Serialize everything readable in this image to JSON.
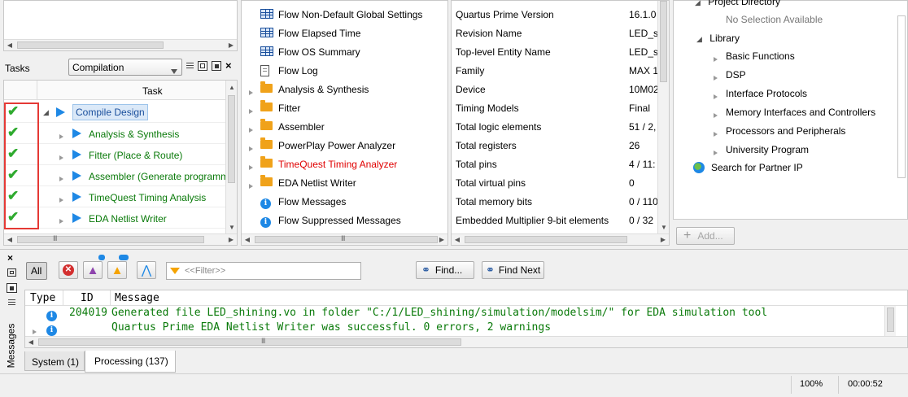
{
  "tasks_pane": {
    "label": "Tasks",
    "flow_select": "Compilation",
    "column_task": "Task",
    "items": [
      {
        "label": "Compile Design",
        "status": "done",
        "color": "#1a4f9c",
        "expanded": true
      },
      {
        "label": "Analysis & Synthesis",
        "status": "done",
        "color": "#0a7a0a"
      },
      {
        "label": "Fitter (Place & Route)",
        "status": "done",
        "color": "#0a7a0a"
      },
      {
        "label": "Assembler (Generate programm",
        "status": "done",
        "color": "#0a7a0a"
      },
      {
        "label": "TimeQuest Timing Analysis",
        "status": "done",
        "color": "#0a7a0a"
      },
      {
        "label": "EDA Netlist Writer",
        "status": "done",
        "color": "#0a7a0a"
      }
    ]
  },
  "report_list": {
    "items": [
      {
        "icon": "table-icon",
        "label": "Flow Non-Default Global Settings",
        "expandable": false
      },
      {
        "icon": "table-icon",
        "label": "Flow Elapsed Time",
        "expandable": false
      },
      {
        "icon": "table-icon",
        "label": "Flow OS Summary",
        "expandable": false
      },
      {
        "icon": "document-icon",
        "label": "Flow Log",
        "expandable": false
      },
      {
        "icon": "folder-icon",
        "label": "Analysis & Synthesis",
        "expandable": true
      },
      {
        "icon": "folder-icon",
        "label": "Fitter",
        "expandable": true
      },
      {
        "icon": "folder-icon",
        "label": "Assembler",
        "expandable": true
      },
      {
        "icon": "folder-icon",
        "label": "PowerPlay Power Analyzer",
        "expandable": true
      },
      {
        "icon": "folder-icon",
        "label": "TimeQuest Timing Analyzer",
        "expandable": true,
        "color": "#e00000"
      },
      {
        "icon": "folder-icon",
        "label": "EDA Netlist Writer",
        "expandable": true
      },
      {
        "icon": "info-icon",
        "label": "Flow Messages",
        "expandable": false
      },
      {
        "icon": "info-icon",
        "label": "Flow Suppressed Messages",
        "expandable": false
      }
    ]
  },
  "summary": {
    "rows": [
      {
        "name": "Quartus Prime Version",
        "value": "16.1.0"
      },
      {
        "name": "Revision Name",
        "value": "LED_s"
      },
      {
        "name": "Top-level Entity Name",
        "value": "LED_s"
      },
      {
        "name": "Family",
        "value": "MAX 1"
      },
      {
        "name": "Device",
        "value": "10M02"
      },
      {
        "name": "Timing Models",
        "value": "Final"
      },
      {
        "name": "Total logic elements",
        "value": "51 / 2,"
      },
      {
        "name": "Total registers",
        "value": "26"
      },
      {
        "name": "Total pins",
        "value": "4 / 11:"
      },
      {
        "name": "Total virtual pins",
        "value": "0"
      },
      {
        "name": "Total memory bits",
        "value": "0 / 110"
      },
      {
        "name": "Embedded Multiplier 9-bit elements",
        "value": "0 / 32"
      }
    ]
  },
  "ip_catalog": {
    "project_directory": "Project Directory",
    "no_selection": "No Selection Available",
    "library": "Library",
    "items": [
      "Basic Functions",
      "DSP",
      "Interface Protocols",
      "Memory Interfaces and Controllers",
      "Processors and Peripherals",
      "University Program"
    ],
    "search_partner": "Search for Partner IP",
    "add_button": "Add..."
  },
  "messages": {
    "side_label": "Messages",
    "all_button": "All",
    "filter_placeholder": "<<Filter>>",
    "find_button": "Find...",
    "find_next_button": "Find Next",
    "columns": {
      "type": "Type",
      "id": "ID",
      "message": "Message"
    },
    "rows": [
      {
        "id": "204019",
        "text": "Generated file LED_shining.vo in folder \"C:/1/LED_shining/simulation/modelsim/\" for EDA simulation tool",
        "expandable": false
      },
      {
        "id": "",
        "text": "Quartus Prime EDA Netlist Writer was successful. 0 errors, 2 warnings",
        "expandable": true
      }
    ],
    "tabs": [
      {
        "label": "System (1)",
        "active": false
      },
      {
        "label": "Processing (137)",
        "active": true
      }
    ]
  },
  "status_bar": {
    "zoom": "100%",
    "elapsed": "00:00:52"
  },
  "colors": {
    "highlight_border": "#e53935",
    "message_text": "#0a7a0a",
    "accent_blue": "#1e88e5"
  }
}
